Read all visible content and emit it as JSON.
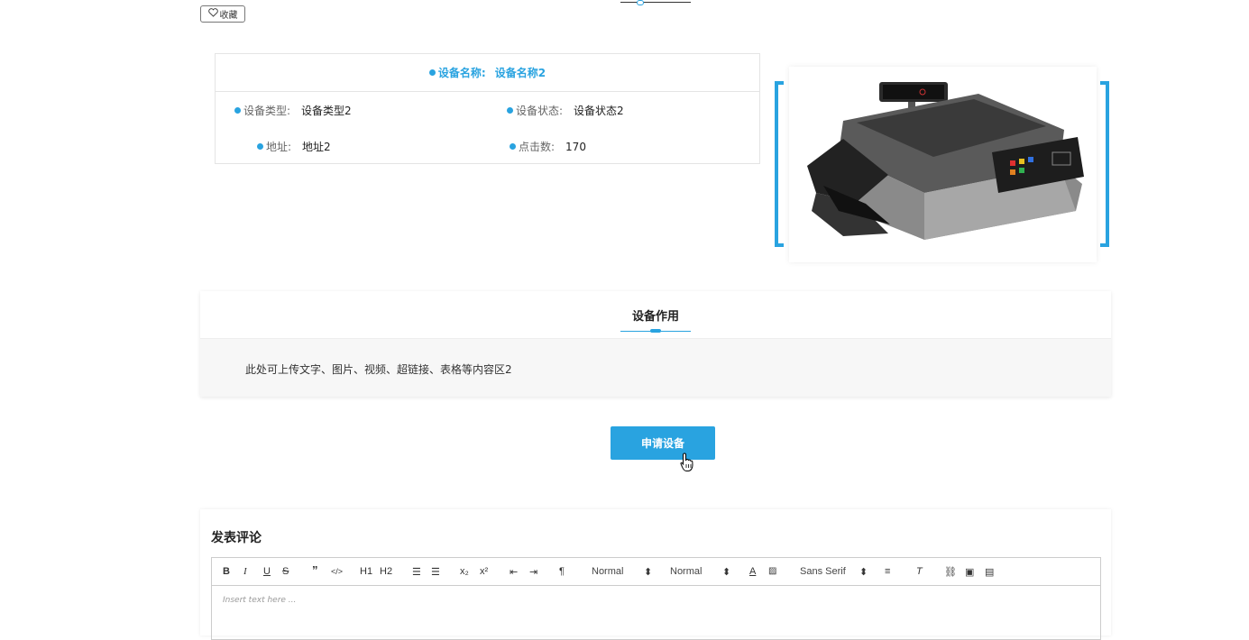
{
  "favorite": {
    "label": "收藏",
    "icon": "heart-icon"
  },
  "device": {
    "name_label": "设备名称:",
    "name_value": "设备名称2",
    "fields": [
      {
        "label": "设备类型:",
        "value": "设备类型2"
      },
      {
        "label": "设备状态:",
        "value": "设备状态2"
      },
      {
        "label": "地址:",
        "value": "地址2"
      },
      {
        "label": "点击数:",
        "value": "170"
      }
    ]
  },
  "function_section": {
    "title": "设备作用",
    "content": "此处可上传文字、图片、视频、超链接、表格等内容区2"
  },
  "apply_button": {
    "label": "申请设备"
  },
  "comment": {
    "title": "发表评论",
    "placeholder": "Insert text here ...",
    "toolbar": {
      "bold": "B",
      "italic": "I",
      "underline": "U",
      "strike": "S",
      "quote": "”",
      "code": "</>",
      "h1": "H1",
      "h2": "H2",
      "header_select": "Normal",
      "size_select": "Normal",
      "font_select": "Sans Serif"
    }
  },
  "colors": {
    "accent": "#29a3e0"
  }
}
